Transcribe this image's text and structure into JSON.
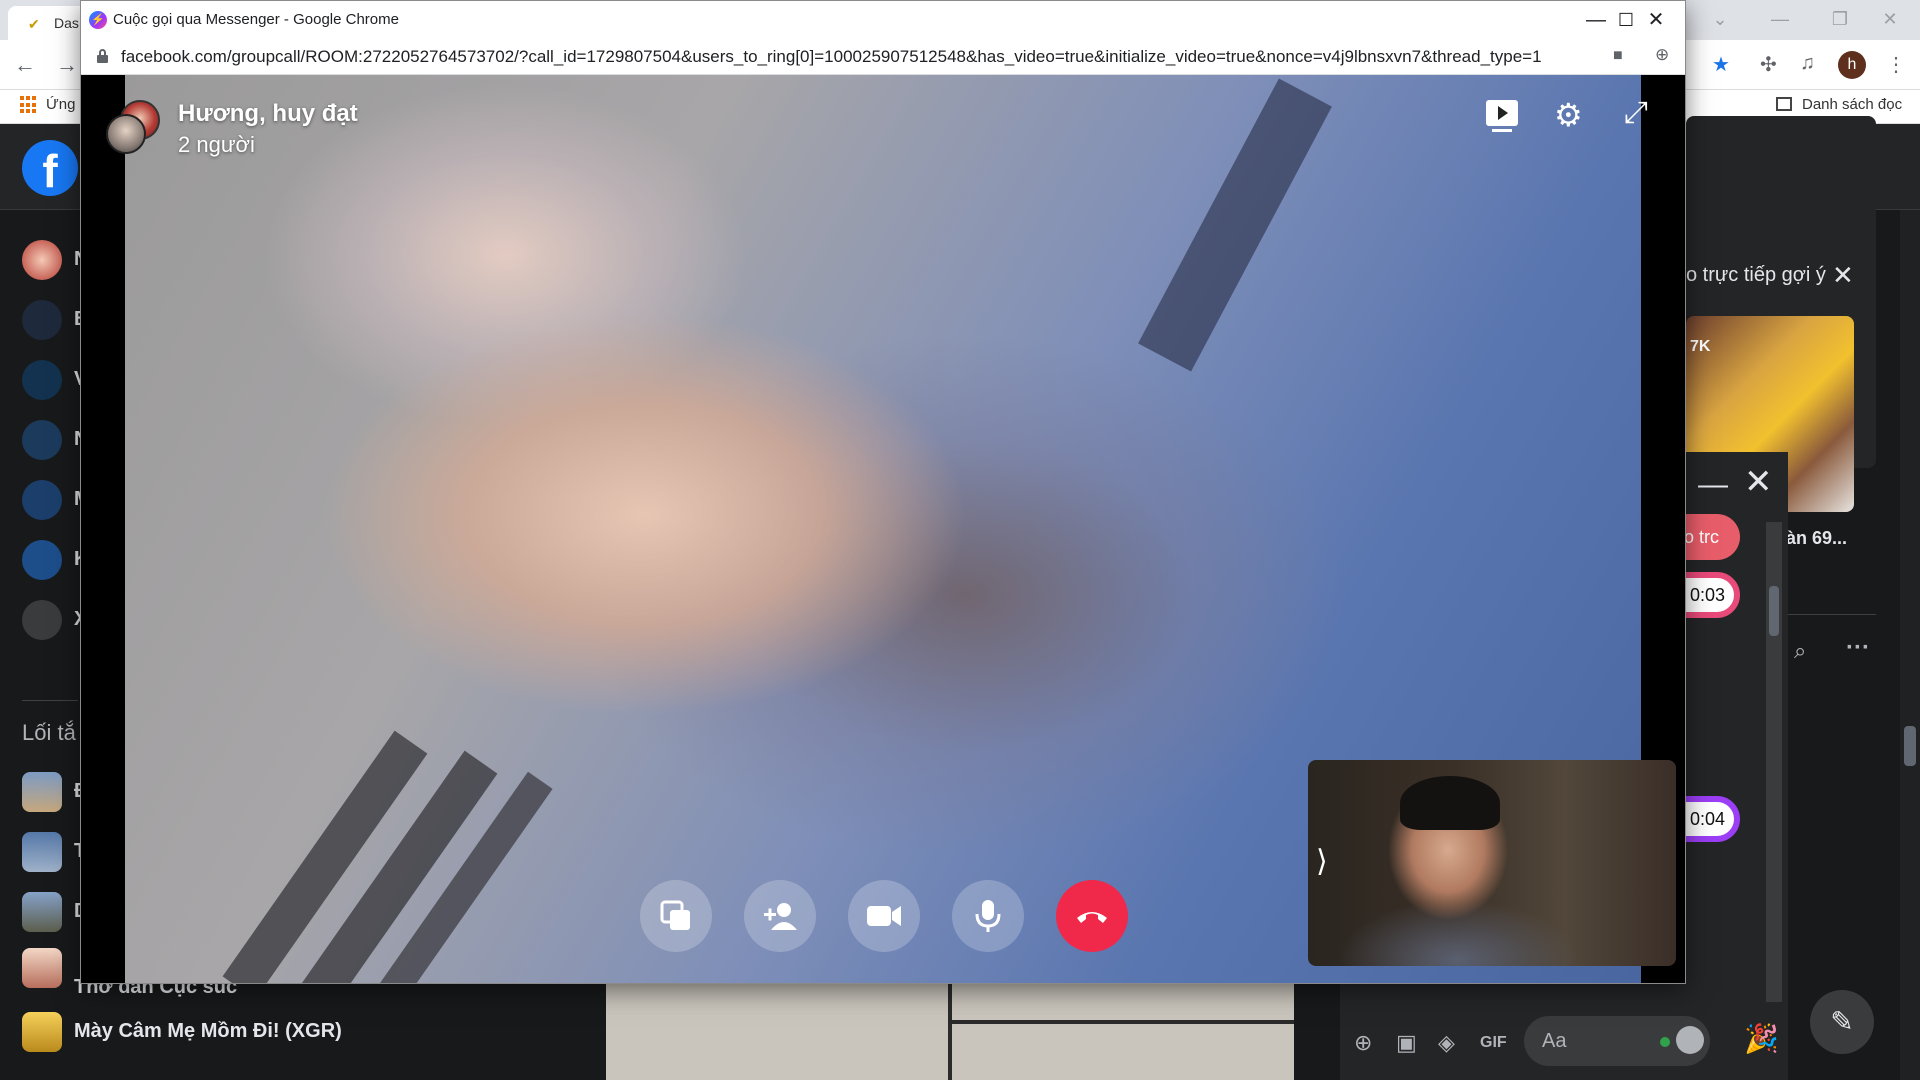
{
  "background_browser": {
    "tab_title": "Das",
    "bookmark_apps": "Ứng",
    "reading_list": "Danh sách đọc",
    "profile_initial": "h"
  },
  "fb": {
    "left_items": [
      "N",
      "B",
      "V",
      "N",
      "M",
      "K",
      "X"
    ],
    "shortcuts_heading": "Lối tắ",
    "shortcuts": [
      {
        "label": "Đ"
      },
      {
        "label": "T"
      },
      {
        "label": "D"
      },
      {
        "label": "Thơ dân Cục súc"
      },
      {
        "label": "Mày Câm Mẹ Mồm Đi! (XGR)"
      }
    ],
    "right_panel": {
      "live_suggest": "o trực tiếp gợi ý",
      "suggest_count": "7K",
      "suggest_caption": "àn 69..."
    },
    "chat": {
      "bubbles": [
        "o trc",
        "0:03",
        "0:04"
      ],
      "input_placeholder": "Aa",
      "gif_label": "GIF"
    }
  },
  "call_window": {
    "title": "Cuộc gọi qua Messenger - Google Chrome",
    "url": "facebook.com/groupcall/ROOM:2722052764573702/?call_id=1729807504&users_to_ring[0]=100025907512548&has_video=true&initialize_video=true&nonce=v4j9lbnsxvn7&thread_type=1",
    "group_name": "Hương, huy đạt",
    "participants": "2 người"
  },
  "colors": {
    "end_call": "#f02849",
    "facebook_blue": "#1877f2",
    "dark_bg": "#18191a"
  },
  "icons": [
    "screen-share-icon",
    "add-person-icon",
    "video-camera-icon",
    "microphone-icon",
    "end-call-icon",
    "settings-icon",
    "fullscreen-icon",
    "present-icon"
  ]
}
